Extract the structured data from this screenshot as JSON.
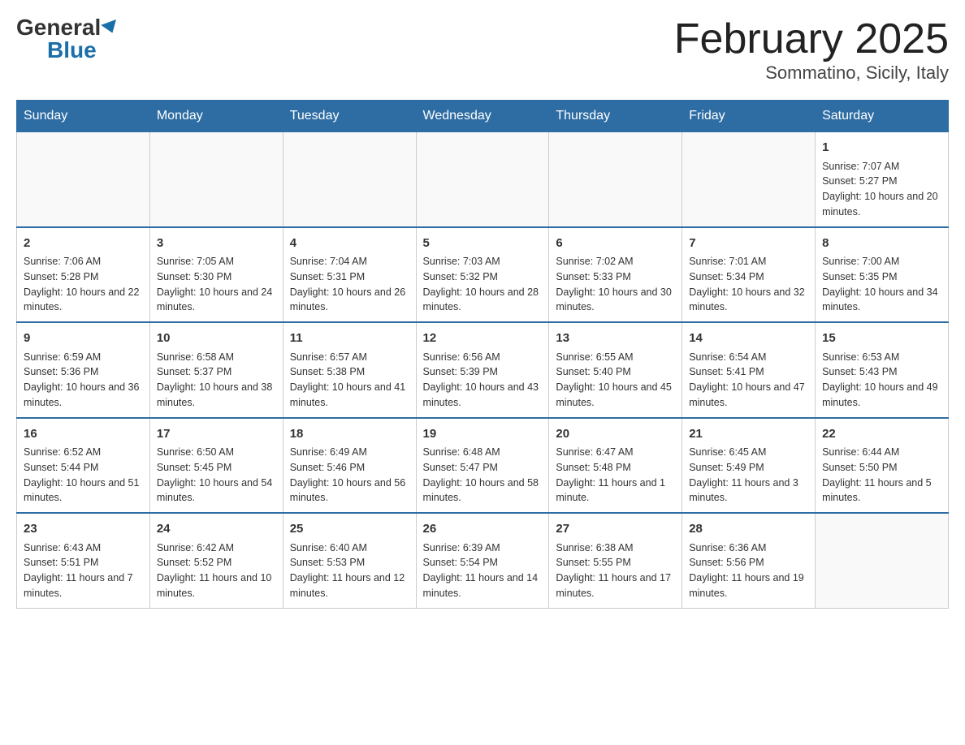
{
  "header": {
    "logo_general": "General",
    "logo_blue": "Blue",
    "month_title": "February 2025",
    "location": "Sommatino, Sicily, Italy"
  },
  "days_of_week": [
    "Sunday",
    "Monday",
    "Tuesday",
    "Wednesday",
    "Thursday",
    "Friday",
    "Saturday"
  ],
  "weeks": [
    [
      {
        "day": "",
        "sunrise": "",
        "sunset": "",
        "daylight": ""
      },
      {
        "day": "",
        "sunrise": "",
        "sunset": "",
        "daylight": ""
      },
      {
        "day": "",
        "sunrise": "",
        "sunset": "",
        "daylight": ""
      },
      {
        "day": "",
        "sunrise": "",
        "sunset": "",
        "daylight": ""
      },
      {
        "day": "",
        "sunrise": "",
        "sunset": "",
        "daylight": ""
      },
      {
        "day": "",
        "sunrise": "",
        "sunset": "",
        "daylight": ""
      },
      {
        "day": "1",
        "sunrise": "Sunrise: 7:07 AM",
        "sunset": "Sunset: 5:27 PM",
        "daylight": "Daylight: 10 hours and 20 minutes."
      }
    ],
    [
      {
        "day": "2",
        "sunrise": "Sunrise: 7:06 AM",
        "sunset": "Sunset: 5:28 PM",
        "daylight": "Daylight: 10 hours and 22 minutes."
      },
      {
        "day": "3",
        "sunrise": "Sunrise: 7:05 AM",
        "sunset": "Sunset: 5:30 PM",
        "daylight": "Daylight: 10 hours and 24 minutes."
      },
      {
        "day": "4",
        "sunrise": "Sunrise: 7:04 AM",
        "sunset": "Sunset: 5:31 PM",
        "daylight": "Daylight: 10 hours and 26 minutes."
      },
      {
        "day": "5",
        "sunrise": "Sunrise: 7:03 AM",
        "sunset": "Sunset: 5:32 PM",
        "daylight": "Daylight: 10 hours and 28 minutes."
      },
      {
        "day": "6",
        "sunrise": "Sunrise: 7:02 AM",
        "sunset": "Sunset: 5:33 PM",
        "daylight": "Daylight: 10 hours and 30 minutes."
      },
      {
        "day": "7",
        "sunrise": "Sunrise: 7:01 AM",
        "sunset": "Sunset: 5:34 PM",
        "daylight": "Daylight: 10 hours and 32 minutes."
      },
      {
        "day": "8",
        "sunrise": "Sunrise: 7:00 AM",
        "sunset": "Sunset: 5:35 PM",
        "daylight": "Daylight: 10 hours and 34 minutes."
      }
    ],
    [
      {
        "day": "9",
        "sunrise": "Sunrise: 6:59 AM",
        "sunset": "Sunset: 5:36 PM",
        "daylight": "Daylight: 10 hours and 36 minutes."
      },
      {
        "day": "10",
        "sunrise": "Sunrise: 6:58 AM",
        "sunset": "Sunset: 5:37 PM",
        "daylight": "Daylight: 10 hours and 38 minutes."
      },
      {
        "day": "11",
        "sunrise": "Sunrise: 6:57 AM",
        "sunset": "Sunset: 5:38 PM",
        "daylight": "Daylight: 10 hours and 41 minutes."
      },
      {
        "day": "12",
        "sunrise": "Sunrise: 6:56 AM",
        "sunset": "Sunset: 5:39 PM",
        "daylight": "Daylight: 10 hours and 43 minutes."
      },
      {
        "day": "13",
        "sunrise": "Sunrise: 6:55 AM",
        "sunset": "Sunset: 5:40 PM",
        "daylight": "Daylight: 10 hours and 45 minutes."
      },
      {
        "day": "14",
        "sunrise": "Sunrise: 6:54 AM",
        "sunset": "Sunset: 5:41 PM",
        "daylight": "Daylight: 10 hours and 47 minutes."
      },
      {
        "day": "15",
        "sunrise": "Sunrise: 6:53 AM",
        "sunset": "Sunset: 5:43 PM",
        "daylight": "Daylight: 10 hours and 49 minutes."
      }
    ],
    [
      {
        "day": "16",
        "sunrise": "Sunrise: 6:52 AM",
        "sunset": "Sunset: 5:44 PM",
        "daylight": "Daylight: 10 hours and 51 minutes."
      },
      {
        "day": "17",
        "sunrise": "Sunrise: 6:50 AM",
        "sunset": "Sunset: 5:45 PM",
        "daylight": "Daylight: 10 hours and 54 minutes."
      },
      {
        "day": "18",
        "sunrise": "Sunrise: 6:49 AM",
        "sunset": "Sunset: 5:46 PM",
        "daylight": "Daylight: 10 hours and 56 minutes."
      },
      {
        "day": "19",
        "sunrise": "Sunrise: 6:48 AM",
        "sunset": "Sunset: 5:47 PM",
        "daylight": "Daylight: 10 hours and 58 minutes."
      },
      {
        "day": "20",
        "sunrise": "Sunrise: 6:47 AM",
        "sunset": "Sunset: 5:48 PM",
        "daylight": "Daylight: 11 hours and 1 minute."
      },
      {
        "day": "21",
        "sunrise": "Sunrise: 6:45 AM",
        "sunset": "Sunset: 5:49 PM",
        "daylight": "Daylight: 11 hours and 3 minutes."
      },
      {
        "day": "22",
        "sunrise": "Sunrise: 6:44 AM",
        "sunset": "Sunset: 5:50 PM",
        "daylight": "Daylight: 11 hours and 5 minutes."
      }
    ],
    [
      {
        "day": "23",
        "sunrise": "Sunrise: 6:43 AM",
        "sunset": "Sunset: 5:51 PM",
        "daylight": "Daylight: 11 hours and 7 minutes."
      },
      {
        "day": "24",
        "sunrise": "Sunrise: 6:42 AM",
        "sunset": "Sunset: 5:52 PM",
        "daylight": "Daylight: 11 hours and 10 minutes."
      },
      {
        "day": "25",
        "sunrise": "Sunrise: 6:40 AM",
        "sunset": "Sunset: 5:53 PM",
        "daylight": "Daylight: 11 hours and 12 minutes."
      },
      {
        "day": "26",
        "sunrise": "Sunrise: 6:39 AM",
        "sunset": "Sunset: 5:54 PM",
        "daylight": "Daylight: 11 hours and 14 minutes."
      },
      {
        "day": "27",
        "sunrise": "Sunrise: 6:38 AM",
        "sunset": "Sunset: 5:55 PM",
        "daylight": "Daylight: 11 hours and 17 minutes."
      },
      {
        "day": "28",
        "sunrise": "Sunrise: 6:36 AM",
        "sunset": "Sunset: 5:56 PM",
        "daylight": "Daylight: 11 hours and 19 minutes."
      },
      {
        "day": "",
        "sunrise": "",
        "sunset": "",
        "daylight": ""
      }
    ]
  ]
}
